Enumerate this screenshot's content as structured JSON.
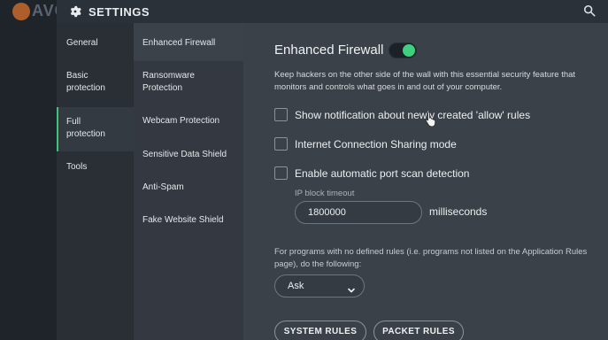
{
  "background_app": {
    "logo_text": "AVG"
  },
  "titlebar": {
    "title": "SETTINGS",
    "gear_icon": "gear-icon",
    "search_icon": "search-icon"
  },
  "category_nav": {
    "items": [
      {
        "label_line1": "General",
        "label_line2": ""
      },
      {
        "label_line1": "Basic",
        "label_line2": "protection"
      },
      {
        "label_line1": "Full",
        "label_line2": "protection",
        "active": true
      },
      {
        "label_line1": "Tools",
        "label_line2": ""
      }
    ]
  },
  "sub_nav": {
    "items": [
      {
        "label_line1": "Enhanced Firewall",
        "label_line2": "",
        "active": true
      },
      {
        "label_line1": "Ransomware",
        "label_line2": "Protection"
      },
      {
        "label_line1": "Webcam Protection",
        "label_line2": ""
      },
      {
        "label_line1": "Sensitive Data Shield",
        "label_line2": ""
      },
      {
        "label_line1": "Anti-Spam",
        "label_line2": ""
      },
      {
        "label_line1": "Fake Website Shield",
        "label_line2": ""
      }
    ]
  },
  "main": {
    "section_title": "Enhanced Firewall",
    "toggle_on": true,
    "description": "Keep hackers on the other side of the wall with this essential security feature that monitors and controls what goes in and out of your computer.",
    "options": [
      {
        "label": "Show notification about newly created 'allow' rules",
        "checked": false
      },
      {
        "label": "Internet Connection Sharing mode",
        "checked": false
      },
      {
        "label": "Enable automatic port scan detection",
        "checked": false
      }
    ],
    "ip_block": {
      "label": "IP block timeout",
      "value": "1800000",
      "unit": "milliseconds"
    },
    "note_line1": "For programs with no defined rules (i.e. programs not listed on the Application Rules",
    "note_line2": "page), do the following:",
    "default_action": {
      "selected": "Ask"
    },
    "buttons": {
      "system_rules": "SYSTEM RULES",
      "packet_rules": "PACKET RULES"
    }
  },
  "colors": {
    "accent_green": "#3ed07f",
    "window_bg": "#3b4149",
    "nav_bg": "#2a2f36",
    "subnav_bg": "#343941"
  }
}
